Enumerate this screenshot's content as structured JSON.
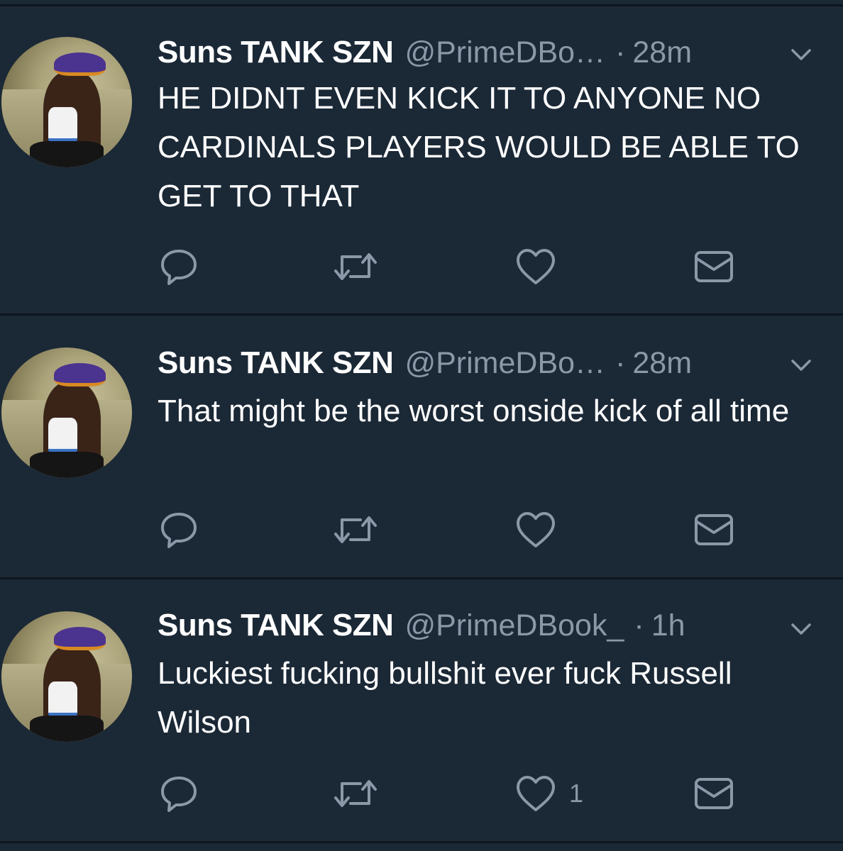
{
  "tweets": [
    {
      "name": "Suns TANK SZN",
      "handle": "@PrimeDBo…",
      "separator": "·",
      "time": "28m",
      "text": "HE DIDNT EVEN KICK IT TO ANYONE NO CARDINALS PLAYERS WOULD BE ABLE TO GET TO THAT",
      "like_count": ""
    },
    {
      "name": "Suns TANK SZN",
      "handle": "@PrimeDBo…",
      "separator": "·",
      "time": "28m",
      "text": "That might be the worst onside kick of all time",
      "like_count": ""
    },
    {
      "name": "Suns TANK SZN",
      "handle": "@PrimeDBook_",
      "separator": "·",
      "time": "1h",
      "text": "Luckiest fucking bullshit ever fuck Russell Wilson",
      "like_count": "1"
    }
  ],
  "icons": {
    "reply": "reply-icon",
    "retweet": "retweet-icon",
    "like": "heart-icon",
    "message": "envelope-icon",
    "more": "chevron-down-icon"
  },
  "colors": {
    "background": "#1b2836",
    "divider": "#0f1620",
    "primary_text": "#ffffff",
    "secondary_text": "#8b98a7",
    "icon": "#8b98a7"
  }
}
